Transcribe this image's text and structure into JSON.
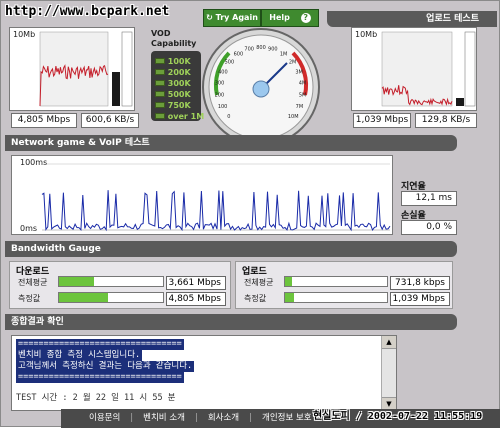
{
  "watermark": "http://www.bcpark.net",
  "download": {
    "title": "",
    "scale_max": "10Mb",
    "speed": "4,805 Mbps",
    "kbs": "600,6 KB/s"
  },
  "upload": {
    "title": "업로드 테스트",
    "scale_max": "10Mb",
    "speed": "1,039 Mbps",
    "kbs": "129,8 KB/s"
  },
  "vod": {
    "title": "VOD\nCapability",
    "items": [
      "100K",
      "200K",
      "300K",
      "500K",
      "750K",
      "over 1M"
    ]
  },
  "gauge": {
    "try_again": "Try Again",
    "help": "Help",
    "help_icon": "?",
    "ticks": [
      "0",
      "100",
      "200",
      "300",
      "400",
      "500",
      "600",
      "700",
      "800",
      "900",
      "1M",
      "2M",
      "3M",
      "4M",
      "5M",
      "7M",
      "10M"
    ]
  },
  "network": {
    "title": "Network game & VoIP 테스트",
    "y_top": "100ms",
    "y_bottom": "0ms",
    "latency_label": "지연율",
    "latency_value": "12,1 ms",
    "loss_label": "손실율",
    "loss_value": "0,0 %"
  },
  "bandwidth": {
    "title": "Bandwidth Gauge",
    "download_title": "다운로드",
    "upload_title": "업로드",
    "avg_label": "전체평균",
    "measured_label": "측정값",
    "download_avg": "3,661 Mbps",
    "download_measured": "4,805 Mbps",
    "upload_avg": "731,8 kbps",
    "upload_measured": "1,039 Mbps",
    "download_avg_fill": 0.34,
    "download_measured_fill": 0.47,
    "upload_avg_fill": 0.07,
    "upload_measured_fill": 0.09
  },
  "results": {
    "title": "종합결과 확인",
    "lines": [
      "================================",
      "벤치비 종합 측정 시스템입니다.",
      "고객님께서 측정하신 결과는 다음과 같습니다.",
      "================================"
    ],
    "cut_line": "TEST 시간 :          2 월 22 일    11 시 55 분"
  },
  "footer": {
    "links": [
      "이용문의",
      "벤치비 소개",
      "회사소개",
      "개인정보 보호"
    ],
    "overlay": "현실도피 / 2002-07-22 11:55:19"
  },
  "colors": {
    "trace_red": "#c41e2a",
    "trace_blue": "#1a2ba8",
    "led_green": "#6b9e3a",
    "bar_green": "#6cc43d"
  }
}
